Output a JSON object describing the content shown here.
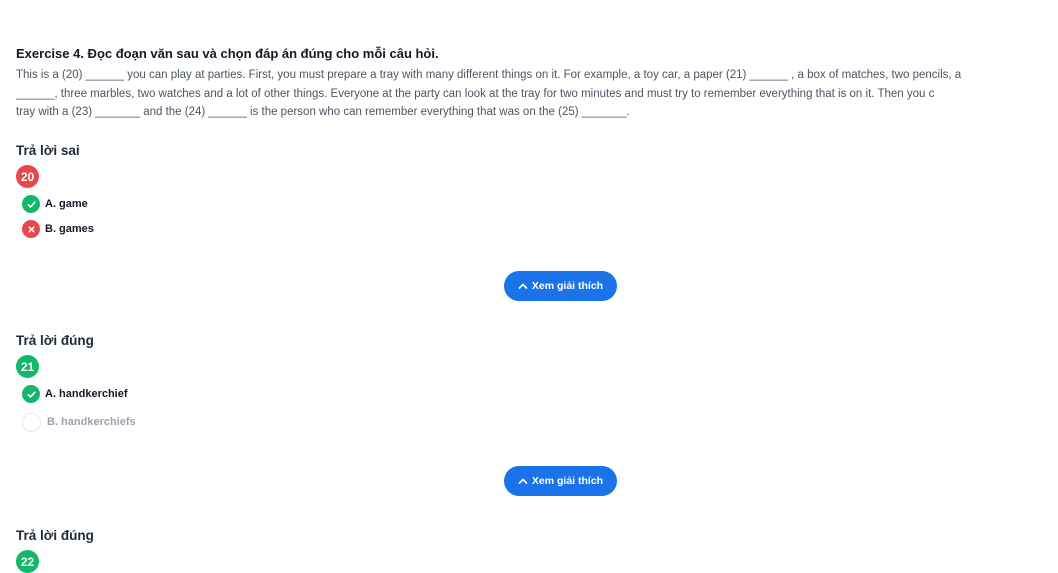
{
  "exercise": {
    "title": "Exercise 4. Đọc đoạn văn sau và chọn đáp án đúng cho mỗi câu hỏi.",
    "passage_lines": [
      "This is a (20) ______ you can play at parties. First, you must prepare a tray with many different things on it. For example, a toy car, a paper (21) ______ , a box of matches, two pencils, a",
      "______, three marbles, two watches and a lot of other things. Everyone at the party can look at the tray for two minutes and must try to remember everything that is on it. Then you c",
      "tray with a (23) _______ and the (24) ______ is the person who can remember everything that was on the (25) _______."
    ]
  },
  "questions": [
    {
      "status": "Trả lời sai",
      "number": "20",
      "options": [
        {
          "label": "A. game",
          "icon": "check-icon"
        },
        {
          "label": "B. games",
          "icon": "cross-icon"
        }
      ],
      "explain_label": "Xem giải thích"
    },
    {
      "status": "Trả lời đúng",
      "number": "21",
      "options": [
        {
          "label": "A. handkerchief",
          "icon": "check-icon"
        },
        {
          "label": "B. handkerchiefs",
          "icon": "empty-circle-icon"
        }
      ],
      "explain_label": "Xem giải thích"
    },
    {
      "status": "Trả lời đúng",
      "number": "22"
    }
  ],
  "colors": {
    "correct": "#12b76a",
    "wrong": "#e5484d",
    "button": "#1a73e8"
  }
}
